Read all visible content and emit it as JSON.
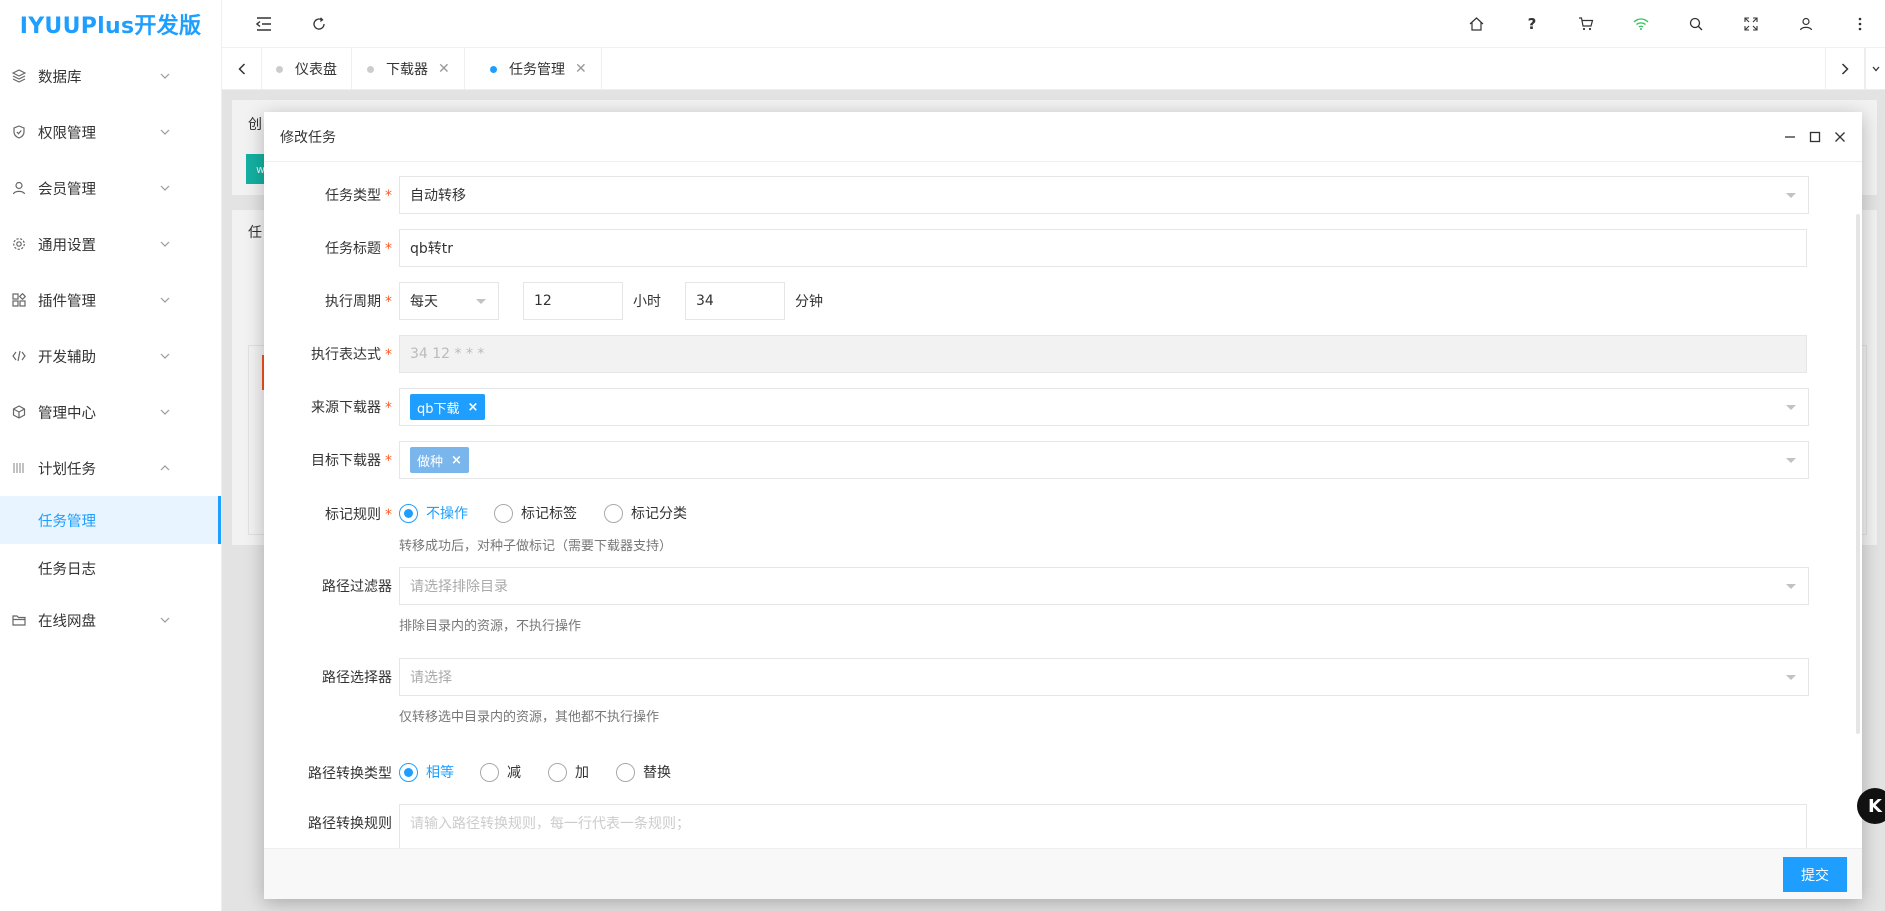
{
  "app": {
    "logo": "IYUUPlus开发版"
  },
  "sidebar": {
    "items": [
      {
        "label": "数据库",
        "icon": "layers-icon"
      },
      {
        "label": "权限管理",
        "icon": "shield-icon"
      },
      {
        "label": "会员管理",
        "icon": "user-icon"
      },
      {
        "label": "通用设置",
        "icon": "gear-icon"
      },
      {
        "label": "插件管理",
        "icon": "apps-icon"
      },
      {
        "label": "开发辅助",
        "icon": "code-icon"
      },
      {
        "label": "管理中心",
        "icon": "cube-icon"
      },
      {
        "label": "计划任务",
        "icon": "calendar-icon"
      },
      {
        "label": "在线网盘",
        "icon": "folder-icon"
      }
    ],
    "sub_items": [
      {
        "label": "任务管理",
        "active": true
      },
      {
        "label": "任务日志",
        "active": false
      }
    ]
  },
  "tabs": [
    {
      "label": "仪表盘",
      "closable": false,
      "active": false
    },
    {
      "label": "下载器",
      "closable": true,
      "active": false
    },
    {
      "label": "任务管理",
      "closable": true,
      "active": true
    }
  ],
  "background": {
    "card_title_fragment": "创",
    "button_fragment": "w",
    "card2_fragment": "任"
  },
  "modal": {
    "title": "修改任务",
    "submit_label": "提交",
    "fields": {
      "task_type": {
        "label": "任务类型",
        "value": "自动转移"
      },
      "task_title": {
        "label": "任务标题",
        "value": "qb转tr"
      },
      "cycle": {
        "label": "执行周期",
        "value": "每天",
        "hour": "12",
        "hour_unit": "小时",
        "minute": "34",
        "minute_unit": "分钟"
      },
      "expression": {
        "label": "执行表达式",
        "value": "34 12 * * *"
      },
      "source_downloader": {
        "label": "来源下载器",
        "chip": "qb下载",
        "chip_color": "#1e9fff"
      },
      "target_downloader": {
        "label": "目标下载器",
        "chip": "做种",
        "chip_color": "#7ab6ec"
      },
      "mark_rule": {
        "label": "标记规则",
        "options": [
          "不操作",
          "标记标签",
          "标记分类"
        ],
        "hint": "转移成功后，对种子做标记（需要下载器支持）"
      },
      "path_filter": {
        "label": "路径过滤器",
        "placeholder": "请选择排除目录",
        "hint": "排除目录内的资源，不执行操作"
      },
      "path_selector": {
        "label": "路径选择器",
        "placeholder": "请选择",
        "hint": "仅转移选中目录内的资源，其他都不执行操作"
      },
      "path_convert_type": {
        "label": "路径转换类型",
        "options": [
          "相等",
          "减",
          "加",
          "替换"
        ]
      },
      "path_convert_rule": {
        "label": "路径转换规则",
        "placeholder": "请输入路径转换规则，每一行代表一条规则；"
      }
    }
  },
  "colors": {
    "accent": "#1e9fff",
    "required": "#ff5722"
  }
}
